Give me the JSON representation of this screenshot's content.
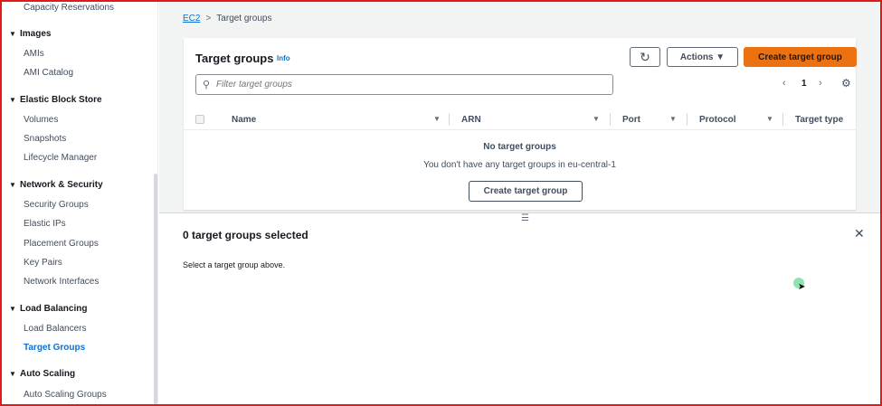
{
  "sidebar": {
    "top_item": "Capacity Reservations",
    "sections": [
      {
        "title": "Images",
        "items": [
          "AMIs",
          "AMI Catalog"
        ]
      },
      {
        "title": "Elastic Block Store",
        "items": [
          "Volumes",
          "Snapshots",
          "Lifecycle Manager"
        ]
      },
      {
        "title": "Network & Security",
        "items": [
          "Security Groups",
          "Elastic IPs",
          "Placement Groups",
          "Key Pairs",
          "Network Interfaces"
        ]
      },
      {
        "title": "Load Balancing",
        "items": [
          "Load Balancers",
          "Target Groups"
        ]
      },
      {
        "title": "Auto Scaling",
        "items": [
          "Auto Scaling Groups"
        ]
      }
    ],
    "active_item": "Target Groups"
  },
  "breadcrumb": {
    "root": "EC2",
    "separator": ">",
    "current": "Target groups"
  },
  "panel": {
    "title": "Target groups",
    "info": "Info",
    "refresh_icon": "refresh-icon",
    "actions_label": "Actions ▼",
    "create_label": "Create target group",
    "search_placeholder": "Filter target groups",
    "page": "1",
    "columns": [
      "Name",
      "ARN",
      "Port",
      "Protocol",
      "Target type"
    ],
    "empty_title": "No target groups",
    "empty_text": "You don't have any target groups in eu-central-1",
    "empty_button": "Create target group"
  },
  "split_panel": {
    "title": "0 target groups selected",
    "text": "Select a target group above."
  },
  "colors": {
    "primary": "#ec7211",
    "link": "#0972d3",
    "border": "#e0191b"
  }
}
